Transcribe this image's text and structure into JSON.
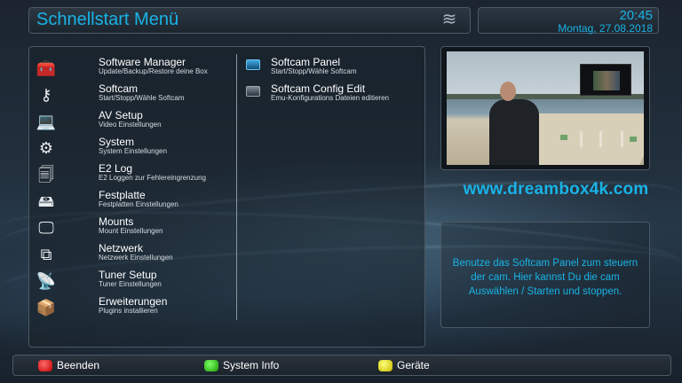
{
  "header": {
    "title": "Schnellstart Menü",
    "time": "20:45",
    "date": "Montag, 27.08.2018",
    "logo_icon": "dreambox-logo-icon"
  },
  "menu": {
    "left_items": [
      {
        "title": "Software Manager",
        "subtitle": "Update/Backup/Restore deine Box",
        "icon": "toolbox-icon"
      },
      {
        "title": "Softcam",
        "subtitle": "Start/Stopp/Wähle Softcam",
        "icon": "key-icon"
      },
      {
        "title": "AV Setup",
        "subtitle": "Video Einstellungen",
        "icon": "laptop-icon"
      },
      {
        "title": "System",
        "subtitle": "System Einstellungen",
        "icon": "gears-icon"
      },
      {
        "title": "E2 Log",
        "subtitle": "E2 Loggen zur Fehlereingrenzung",
        "icon": "document-icon"
      },
      {
        "title": "Festplatte",
        "subtitle": "Festplatten Einstellungen",
        "icon": "harddisk-icon"
      },
      {
        "title": "Mounts",
        "subtitle": "Mount Einstellungen",
        "icon": "monitor-icon"
      },
      {
        "title": "Netzwerk",
        "subtitle": "Netzwerk Einstellungen",
        "icon": "network-icon"
      },
      {
        "title": "Tuner Setup",
        "subtitle": "Tuner Einstellungen",
        "icon": "satellite-icon"
      },
      {
        "title": "Erweiterungen",
        "subtitle": "Plugins installieren",
        "icon": "box-icon"
      }
    ],
    "right_items": [
      {
        "title": "Softcam Panel",
        "subtitle": "Start/Stopp/Wähle Softcam",
        "icon": "selected-box-icon"
      },
      {
        "title": "Softcam Config Edit",
        "subtitle": "Emu-Konfigurations Dateien editieren",
        "icon": "box-icon"
      }
    ]
  },
  "site_url": "www.dreambox4k.com",
  "description": "Benutze das Softcam Panel zum steuern der cam. Hier kannst Du die cam Auswählen / Starten und stoppen.",
  "footer": {
    "red_label": "Beenden",
    "green_label": "System Info",
    "yellow_label": "Geräte"
  },
  "colors": {
    "accent": "#19b3e6",
    "red": "#d60000",
    "green": "#29c400",
    "yellow": "#e5d800"
  }
}
